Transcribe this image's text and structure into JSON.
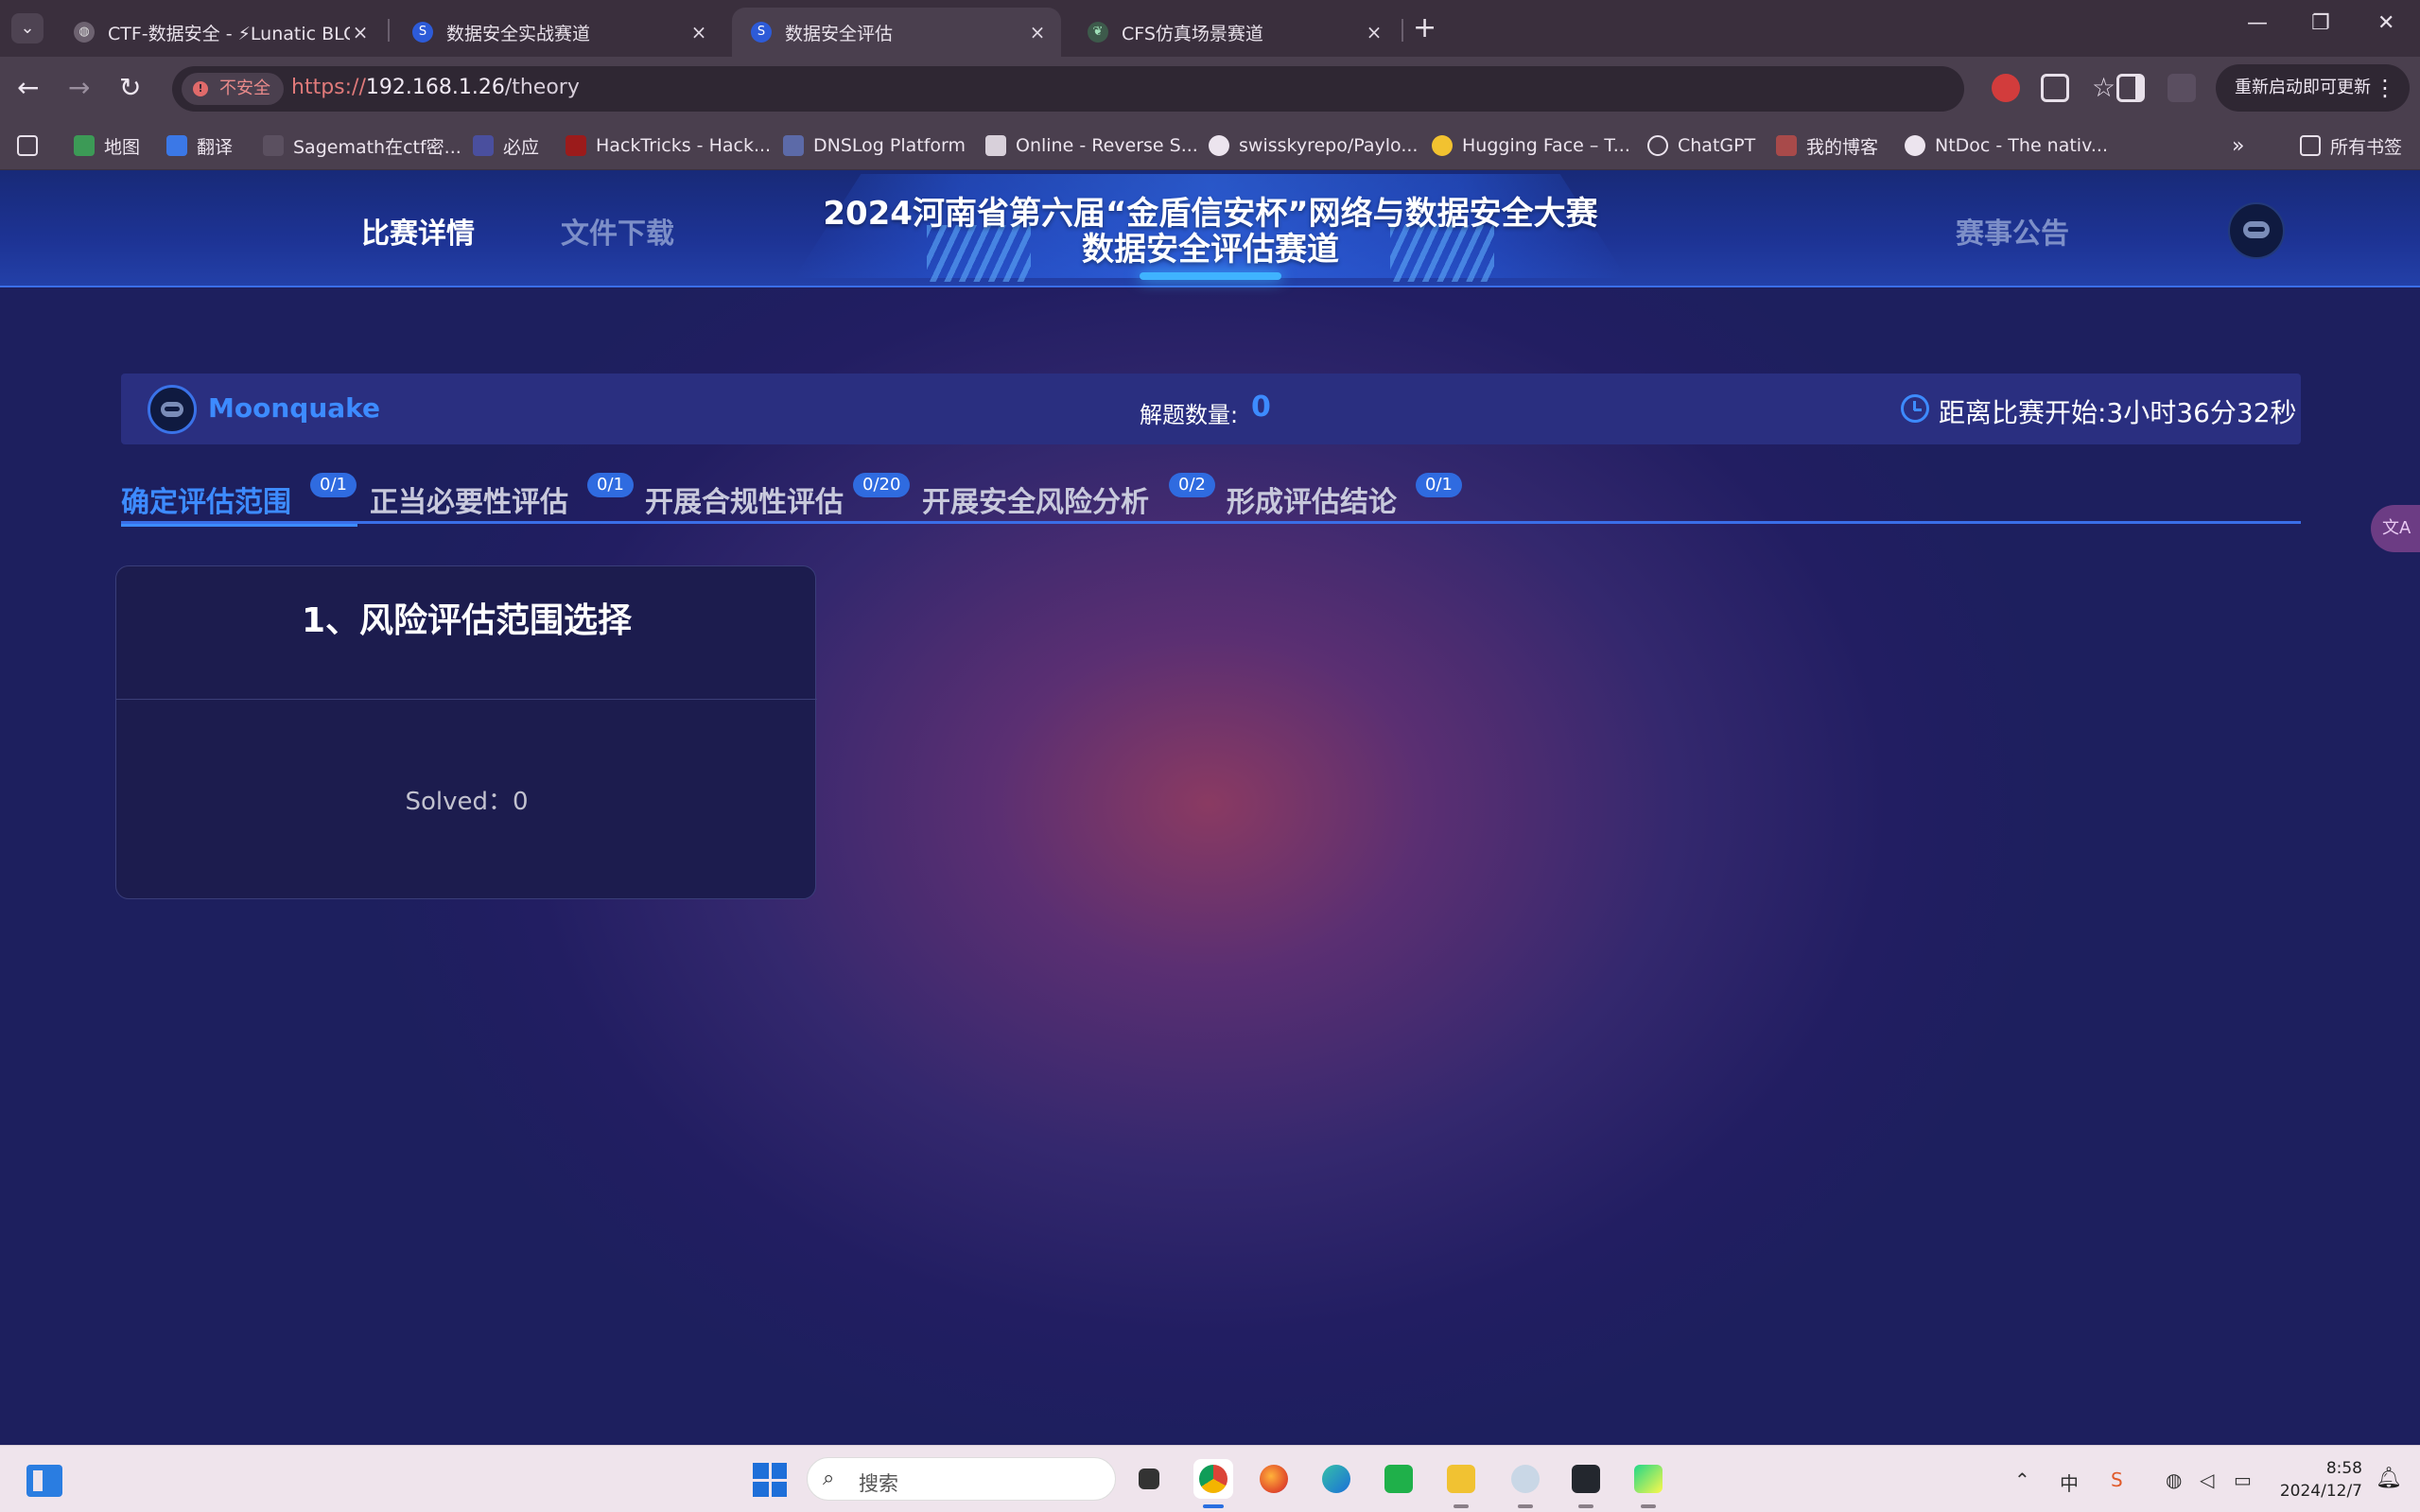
{
  "browser": {
    "tabs": [
      {
        "title": "CTF-数据安全 - ⚡Lunatic BLOG",
        "active": false
      },
      {
        "title": "数据安全实战赛道",
        "active": false
      },
      {
        "title": "数据安全评估",
        "active": true
      },
      {
        "title": "CFS仿真场景赛道",
        "active": false
      }
    ],
    "omnibox": {
      "security_label": "不安全",
      "url_scheme": "https://",
      "url_host": "192.168.1.26",
      "url_path": "/theory"
    },
    "update_button": "重新启动即可更新",
    "bookmarks": [
      "地图",
      "翻译",
      "Sagemath在ctf密...",
      "必应",
      "HackTricks - Hack...",
      "DNSLog Platform",
      "Online - Reverse S...",
      "swisskyrepo/Paylo...",
      "Hugging Face – T...",
      "ChatGPT",
      "我的博客",
      "NtDoc - The nativ..."
    ],
    "bookmarks_folder": "所有书签"
  },
  "site": {
    "nav_left": [
      "比赛详情",
      "文件下载"
    ],
    "nav_right": "赛事公告",
    "banner_line1": "2024河南省第六届“金盾信安杯”网络与数据安全大赛",
    "banner_line2": "数据安全评估赛道"
  },
  "info": {
    "username": "Moonquake",
    "solved_label": "解题数量:",
    "solved_count": "0",
    "countdown": "距离比赛开始:3小时36分32秒"
  },
  "categories": [
    {
      "label": "确定评估范围",
      "badge": "0/1",
      "active": true
    },
    {
      "label": "正当必要性评估",
      "badge": "0/1",
      "active": false
    },
    {
      "label": "开展合规性评估",
      "badge": "0/20",
      "active": false
    },
    {
      "label": "开展安全风险分析",
      "badge": "0/2",
      "active": false
    },
    {
      "label": "形成评估结论",
      "badge": "0/1",
      "active": false
    }
  ],
  "challenge": {
    "title": "1、风险评估范围选择",
    "solved": "Solved：0"
  },
  "taskbar": {
    "search_placeholder": "搜索",
    "ime": "中",
    "time": "8:58",
    "date": "2024/12/7"
  },
  "colors": {
    "accent": "#3d8bff",
    "page_bg": "#1d1f5e",
    "header_bg": "#1d3394",
    "card_bg": "#1c1c4e"
  }
}
